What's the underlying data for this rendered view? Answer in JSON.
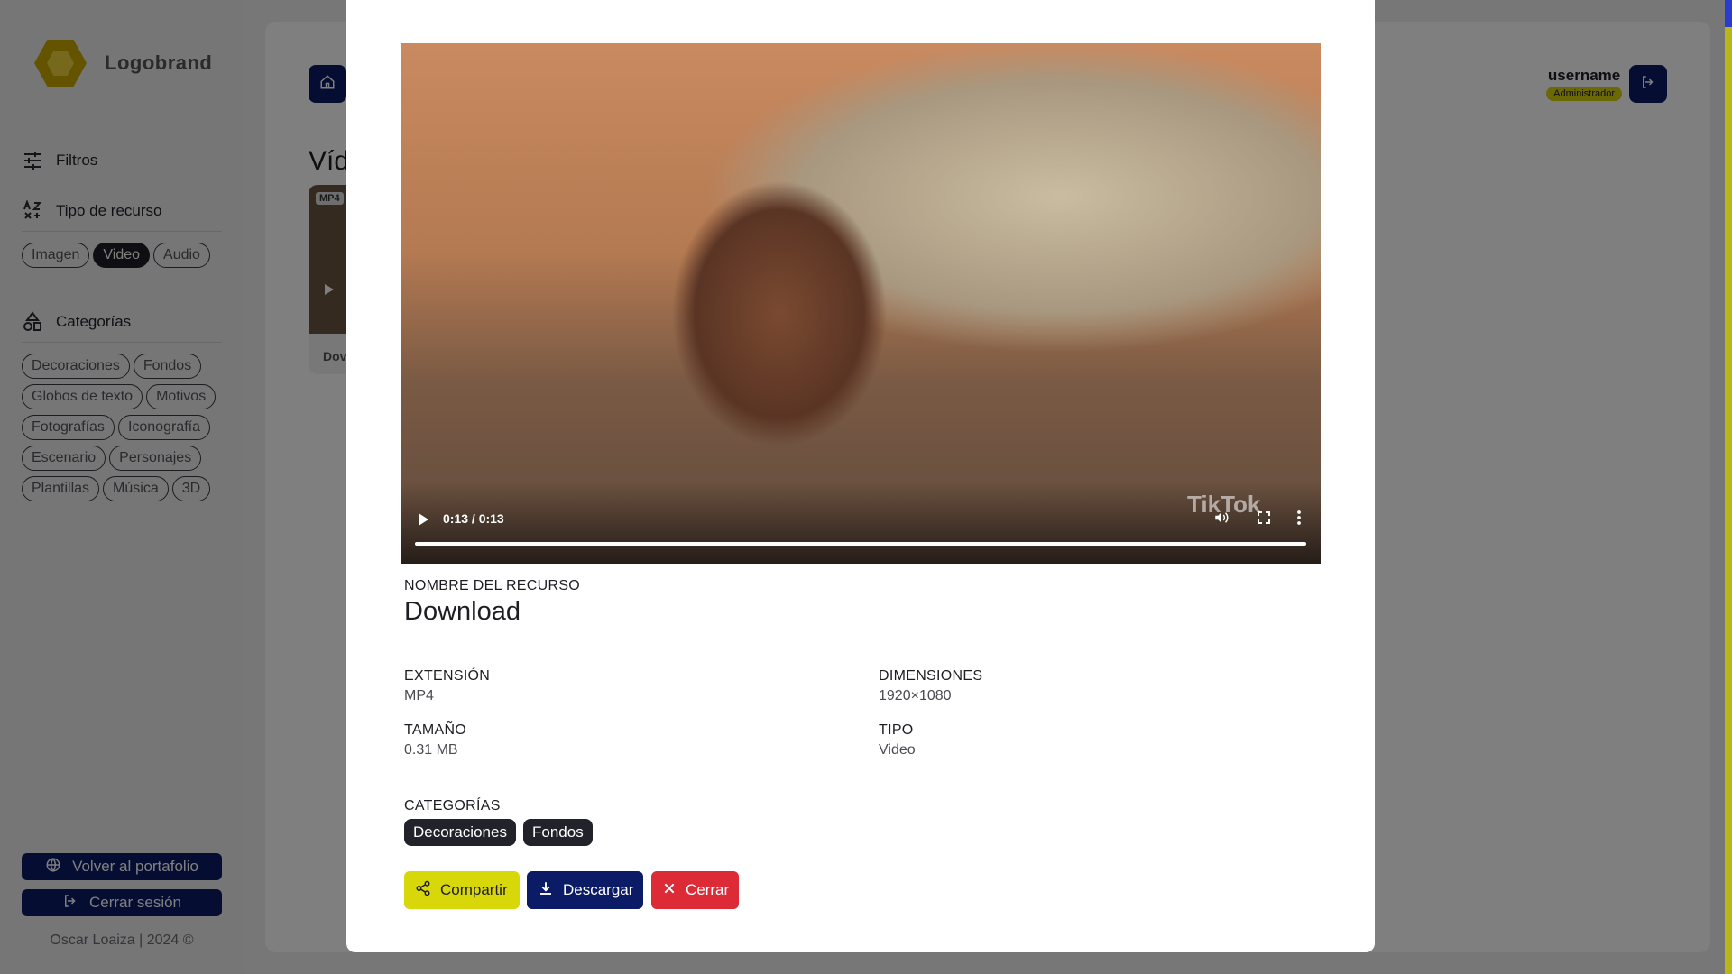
{
  "app": {
    "logo_text": "Logobrand"
  },
  "sidebar": {
    "filters_label": "Filtros",
    "resource_type": {
      "label": "Tipo de recurso",
      "options": [
        {
          "label": "Imagen",
          "active": false
        },
        {
          "label": "Video",
          "active": true
        },
        {
          "label": "Audio",
          "active": false
        }
      ]
    },
    "categories": {
      "label": "Categorías",
      "options": [
        "Decoraciones",
        "Fondos",
        "Globos de texto",
        "Motivos",
        "Fotografías",
        "Iconografía",
        "Escenario",
        "Personajes",
        "Plantillas",
        "Música",
        "3D"
      ]
    },
    "back_button": "Volver al portafolio",
    "logout_button": "Cerrar sesión",
    "footer": "Oscar Loaiza | 2024 ©"
  },
  "main": {
    "page_title": "Víd",
    "card": {
      "badge": "MP4",
      "name": "Dov"
    },
    "user": {
      "username": "username",
      "role": "Administrador"
    }
  },
  "modal": {
    "video": {
      "time": "0:13 / 0:13",
      "progress": 1.0,
      "watermark": "TikTok"
    },
    "name_label": "NOMBRE DEL RECURSO",
    "name_value": "Download",
    "extension_label": "EXTENSIÓN",
    "extension_value": "MP4",
    "dimensions_label": "DIMENSIONES",
    "dimensions_value": "1920×1080",
    "size_label": "TAMAÑO",
    "size_value": "0.31 MB",
    "type_label": "TIPO",
    "type_value": "Video",
    "categories_label": "CATEGORÍAS",
    "categories": [
      "Decoraciones",
      "Fondos"
    ],
    "share_button": "Compartir",
    "download_button": "Descargar",
    "close_button": "Cerrar"
  },
  "colors": {
    "primary": "#0b1b66",
    "accent": "#d8d70a",
    "danger": "#dc2a37",
    "chip_dark": "#22222a"
  }
}
